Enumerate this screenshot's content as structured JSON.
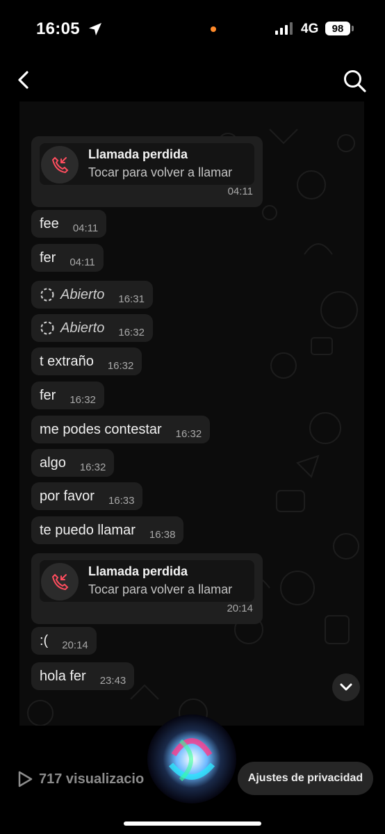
{
  "status_bar": {
    "time": "16:05",
    "network": "4G",
    "battery": "98",
    "dot_color": "#ff8a2a"
  },
  "icons": {
    "back": "chevron-left-icon",
    "search": "search-icon",
    "location": "location-arrow-icon",
    "missed_call": "missed-call-icon",
    "pending": "pending-circle-icon",
    "scroll": "chevron-down-icon",
    "views": "play-icon"
  },
  "chat": {
    "messages": [
      {
        "type": "call",
        "title": "Llamada perdida",
        "subtitle": "Tocar para volver a llamar",
        "time": "04:11"
      },
      {
        "type": "text",
        "text": "fee",
        "time": "04:11"
      },
      {
        "type": "text",
        "text": "fer",
        "time": "04:11"
      },
      {
        "type": "status",
        "text": "Abierto",
        "time": "16:31"
      },
      {
        "type": "status",
        "text": "Abierto",
        "time": "16:32"
      },
      {
        "type": "text",
        "text": "t extraño",
        "time": "16:32"
      },
      {
        "type": "text",
        "text": "fer",
        "time": "16:32"
      },
      {
        "type": "text",
        "text": "me podes contestar",
        "time": "16:32"
      },
      {
        "type": "text",
        "text": "algo",
        "time": "16:32"
      },
      {
        "type": "text",
        "text": "por favor",
        "time": "16:33"
      },
      {
        "type": "text",
        "text": "te puedo llamar",
        "time": "16:38"
      },
      {
        "type": "call",
        "title": "Llamada perdida",
        "subtitle": "Tocar para volver a llamar",
        "time": "20:14"
      },
      {
        "type": "text",
        "text": ":(",
        "time": "20:14"
      },
      {
        "type": "text",
        "text": "hola fer",
        "time": "23:43"
      }
    ]
  },
  "bottom": {
    "views": "717 visualizacio",
    "privacy_button": "Ajustes de privacidad"
  },
  "colors": {
    "bubble": "#1f1f1f",
    "missed_call_red": "#ff4d5e",
    "background": "#000000"
  }
}
